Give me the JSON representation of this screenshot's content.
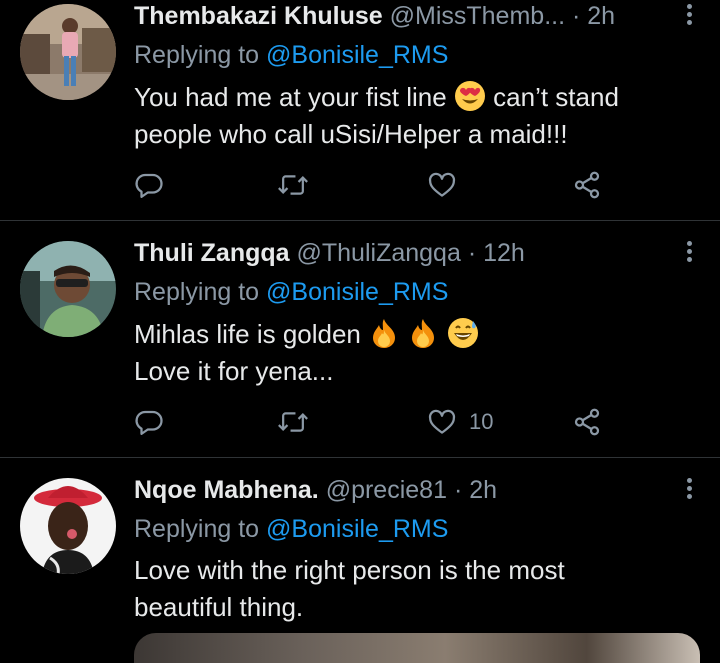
{
  "theme": {
    "background": "#000000",
    "text_primary": "#e7e9ea",
    "text_secondary": "#8b98a5",
    "accent": "#1d9bf0",
    "divider": "#2f3336"
  },
  "tweets": [
    {
      "name": "Thembakazi Khuluse",
      "handle": "@MissThemb...",
      "separator": "·",
      "time": "2h",
      "replying_prefix": "Replying to ",
      "replying_to": "@Bonisile_RMS",
      "text_line1_a": "You had me at your fist line",
      "text_line1_b": "can’t stand",
      "text_line2": "people who call uSisi/Helper a maid!!!",
      "emojis": [
        "heart-eyes-emoji"
      ],
      "like_count": ""
    },
    {
      "name": "Thuli Zangqa",
      "handle": "@ThuliZangqa",
      "separator": "·",
      "time": "12h",
      "replying_prefix": "Replying to ",
      "replying_to": "@Bonisile_RMS",
      "text_line1": "Mihlas life is golden",
      "text_line2": "Love it for yena...",
      "emojis": [
        "fire-emoji",
        "fire-emoji",
        "grinning-sweat-emoji"
      ],
      "like_count": "10"
    },
    {
      "name": "Nqoe Mabhena.",
      "handle": "@precie81",
      "separator": "·",
      "time": "2h",
      "replying_prefix": "Replying to ",
      "replying_to": "@Bonisile_RMS",
      "text_line1": "Love with the right person is the most",
      "text_line2": "beautiful thing.",
      "emojis": [],
      "like_count": ""
    }
  ],
  "action_icons": [
    "reply-icon",
    "retweet-icon",
    "like-icon",
    "share-icon"
  ]
}
